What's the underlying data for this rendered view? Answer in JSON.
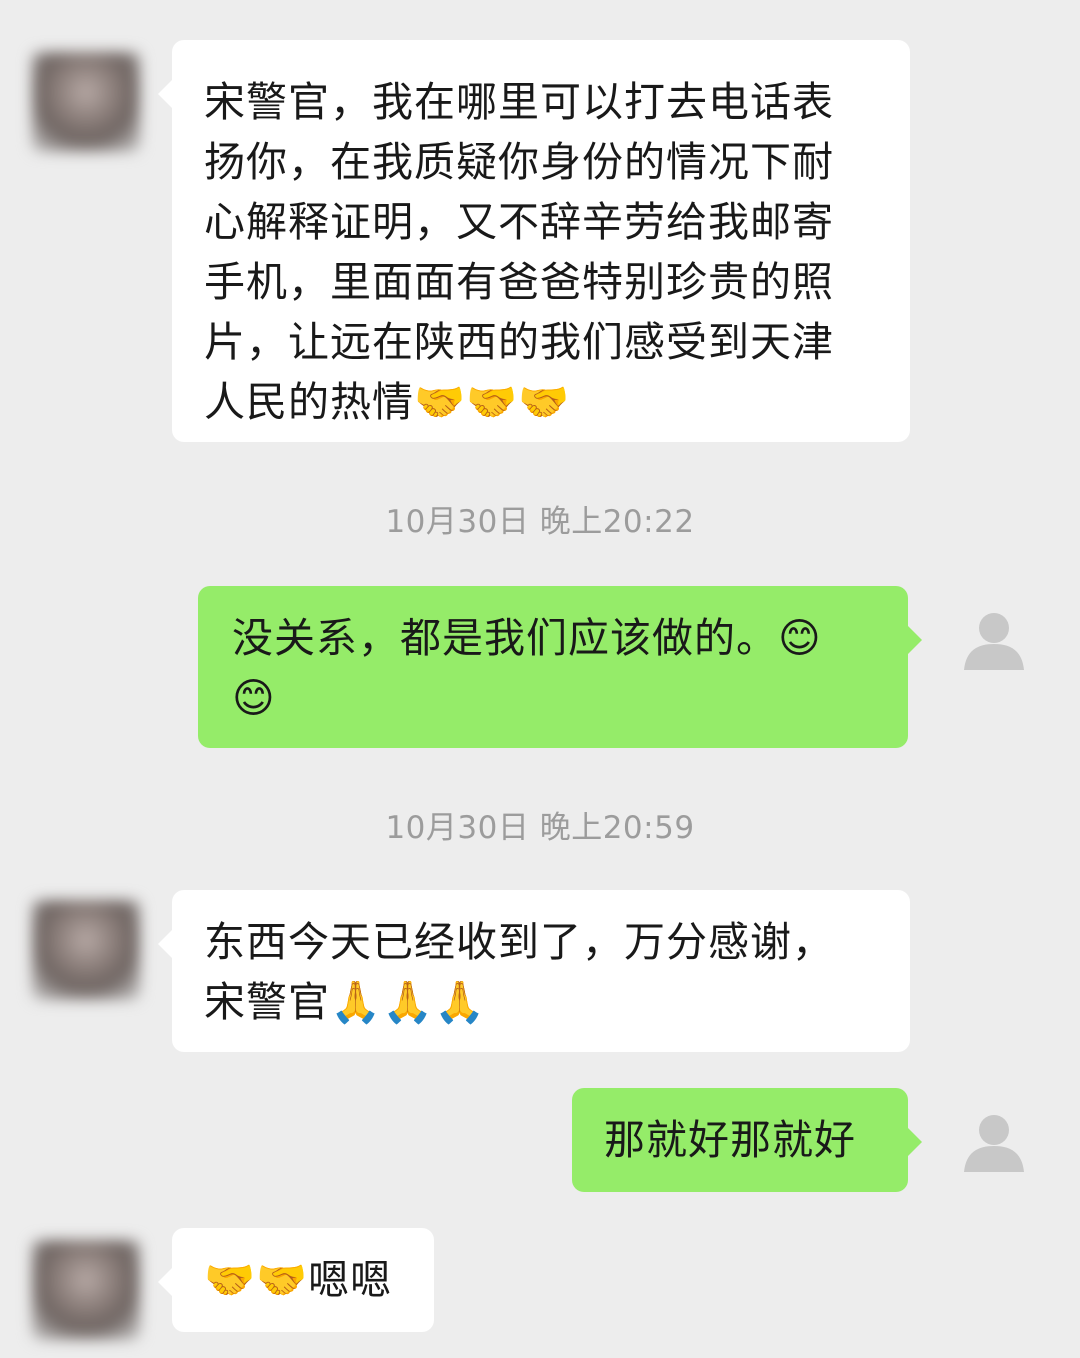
{
  "messages": [
    {
      "sender": "contact",
      "lines": [
        "宋警官，我在哪里可以打去电话表",
        "扬你，在我质疑你身份的情况下耐",
        "心解释证明，又不辞辛劳给我邮寄",
        "手机，里面面有爸爸特别珍贵的照",
        "片，让远在陕西的我们感受到天津",
        "人民的热情🤝🤝🤝"
      ]
    },
    {
      "sender": "me",
      "lines": [
        "没关系，都是我们应该做的。😊",
        "😊"
      ]
    },
    {
      "sender": "contact",
      "lines": [
        "东西今天已经收到了，万分感谢，",
        "宋警官🙏🙏🙏"
      ]
    },
    {
      "sender": "me",
      "lines": [
        "那就好那就好"
      ]
    },
    {
      "sender": "contact",
      "lines": [
        "🤝🤝嗯嗯"
      ]
    }
  ],
  "timestamps": [
    "10月30日 晚上20:22",
    "10月30日 晚上20:59"
  ],
  "colors": {
    "background": "#ededed",
    "incoming_bubble": "#ffffff",
    "outgoing_bubble": "#95ec69",
    "timestamp_text": "#9c9c9c"
  }
}
